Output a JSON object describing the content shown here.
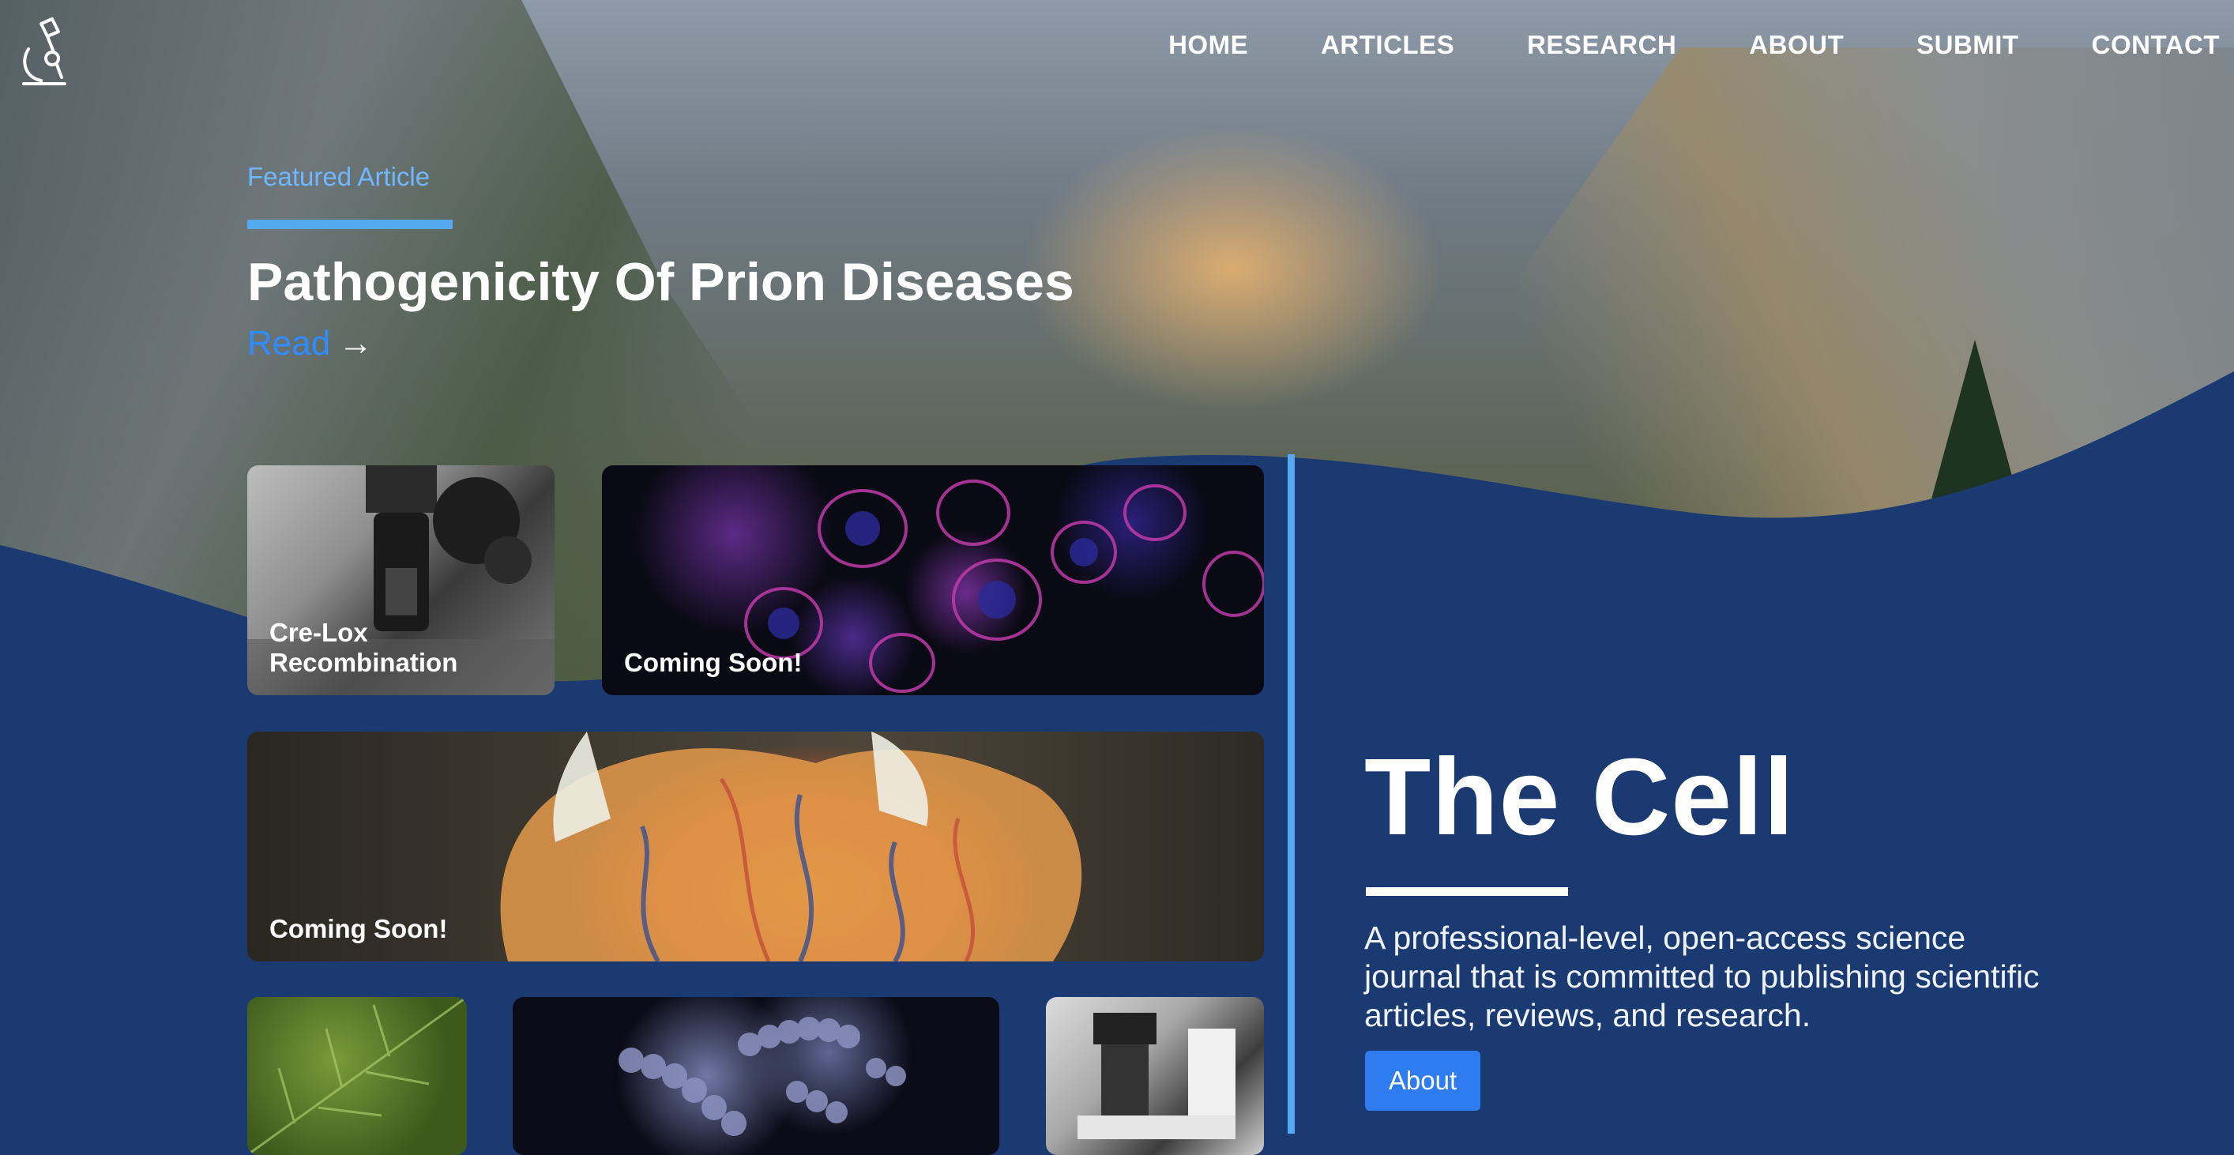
{
  "brand": {
    "logo_icon": "microscope-icon"
  },
  "nav": {
    "items": [
      {
        "label": "HOME"
      },
      {
        "label": "ARTICLES"
      },
      {
        "label": "RESEARCH"
      },
      {
        "label": "ABOUT"
      },
      {
        "label": "SUBMIT"
      },
      {
        "label": "CONTACT"
      }
    ]
  },
  "featured": {
    "label": "Featured Article",
    "title": "Pathogenicity Of Prion Diseases",
    "read_label": "Read",
    "read_arrow": "→"
  },
  "cards": [
    {
      "label": "Cre-Lox Recombination"
    },
    {
      "label": "Coming Soon!"
    },
    {
      "label": "Coming Soon!"
    }
  ],
  "journal": {
    "title": "The Cell",
    "description": "A professional-level, open-access science journal that is committed to publishing scientific articles, reviews, and research.",
    "about_label": "About"
  },
  "colors": {
    "navy": "#1b3a72",
    "accent_blue": "#54a9f1",
    "link_blue": "#2f8cff",
    "button_blue": "#2f7cf0"
  }
}
